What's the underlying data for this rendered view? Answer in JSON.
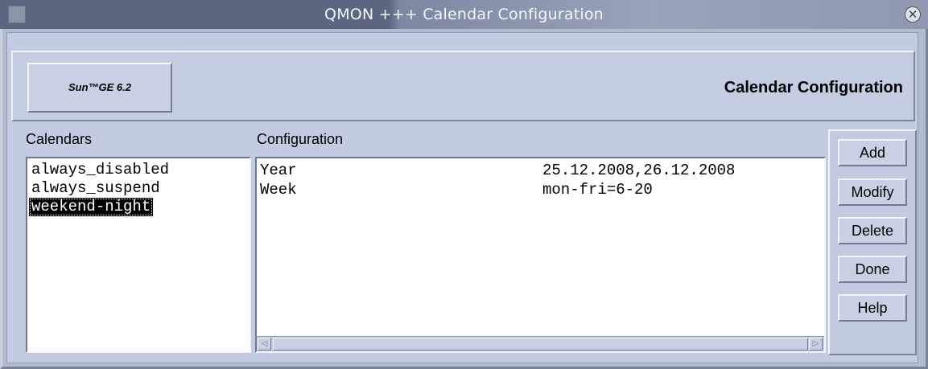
{
  "window": {
    "title": "QMON +++  Calendar Configuration"
  },
  "header": {
    "logo_label": "Sun™GE 6.2",
    "title": "Calendar Configuration"
  },
  "calendars": {
    "label": "Calendars",
    "items": [
      "always_disabled",
      "always_suspend",
      "weekend-night"
    ],
    "selected": "weekend-night"
  },
  "configuration": {
    "label": "Configuration",
    "rows": [
      {
        "key": "Year",
        "value": "25.12.2008,26.12.2008"
      },
      {
        "key": "Week",
        "value": "mon-fri=6-20"
      }
    ]
  },
  "buttons": {
    "add": "Add",
    "modify": "Modify",
    "delete": "Delete",
    "done": "Done",
    "help": "Help"
  },
  "icons": {
    "close": "close-icon",
    "scroll_left": "scroll-left-arrow-icon",
    "scroll_right": "scroll-right-arrow-icon"
  },
  "colors": {
    "window_bg": "#b4bccc",
    "panel_bg": "#c3cbe2",
    "selection_bg": "#000000",
    "list_bg": "#ffffff"
  }
}
